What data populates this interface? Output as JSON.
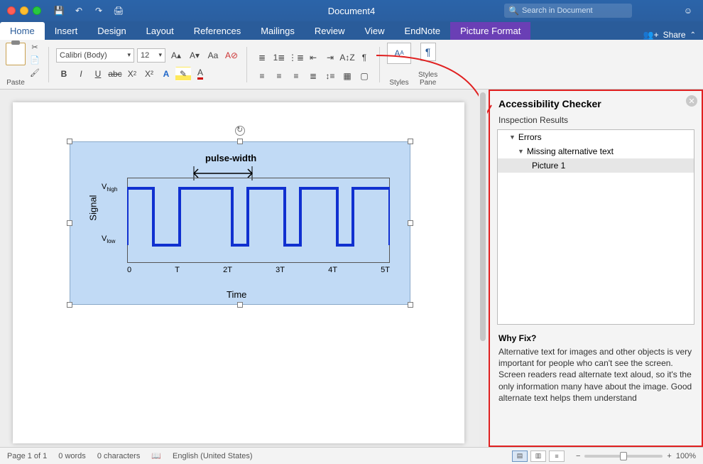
{
  "titlebar": {
    "doc_title": "Document4",
    "search_placeholder": "Search in Document"
  },
  "tabs": {
    "home": "Home",
    "insert": "Insert",
    "design": "Design",
    "layout": "Layout",
    "references": "References",
    "mailings": "Mailings",
    "review": "Review",
    "view": "View",
    "endnote": "EndNote",
    "picture_format": "Picture Format",
    "share": "Share"
  },
  "ribbon": {
    "paste": "Paste",
    "font_name": "Calibri (Body)",
    "font_size": "12",
    "styles": "Styles",
    "styles_pane": "Styles\nPane"
  },
  "chart": {
    "pulse_label": "pulse-width",
    "ylabel": "Signal",
    "xlabel": "Time",
    "v_high": "V",
    "v_high_sub": "high",
    "v_low": "V",
    "v_low_sub": "low",
    "ticks": [
      "0",
      "T",
      "2T",
      "3T",
      "4T",
      "5T"
    ]
  },
  "panel": {
    "title": "Accessibility Checker",
    "subtitle": "Inspection Results",
    "errors_label": "Errors",
    "missing_alt": "Missing alternative text",
    "item1": "Picture 1",
    "whyfix_title": "Why Fix?",
    "whyfix_body": "Alternative text for images and other objects is very important for people who can't see the screen. Screen readers read alternate text aloud, so it's the only information many have about the image. Good alternate text helps them understand"
  },
  "status": {
    "page": "Page 1 of 1",
    "words": "0 words",
    "chars": "0 characters",
    "lang": "English (United States)",
    "zoom": "100%"
  },
  "chart_data": {
    "type": "line",
    "title": "pulse-width",
    "xlabel": "Time",
    "ylabel": "Signal",
    "x_ticks": [
      "0",
      "T",
      "2T",
      "3T",
      "4T",
      "5T"
    ],
    "y_ticks": [
      "V_low",
      "V_high"
    ],
    "annotations": [
      "pulse-width spans T to 2T (high phase)"
    ],
    "series": [
      {
        "name": "Signal",
        "description": "Square pulse train alternating between V_low and V_high each period T, duty cycle ≈ 50%",
        "x": [
          0,
          0,
          0.5,
          0.5,
          1,
          1,
          1.5,
          1.5,
          2,
          2,
          2.5,
          2.5,
          3,
          3,
          3.5,
          3.5,
          4,
          4,
          4.5,
          4.5,
          5
        ],
        "y_sym": [
          "low",
          "high",
          "high",
          "low",
          "low",
          "high",
          "high",
          "low",
          "low",
          "high",
          "high",
          "low",
          "low",
          "high",
          "high",
          "low",
          "low",
          "high",
          "high",
          "low",
          "low"
        ]
      }
    ],
    "xlim": [
      0,
      5
    ],
    "ylim_sym": [
      "V_low",
      "V_high"
    ]
  }
}
